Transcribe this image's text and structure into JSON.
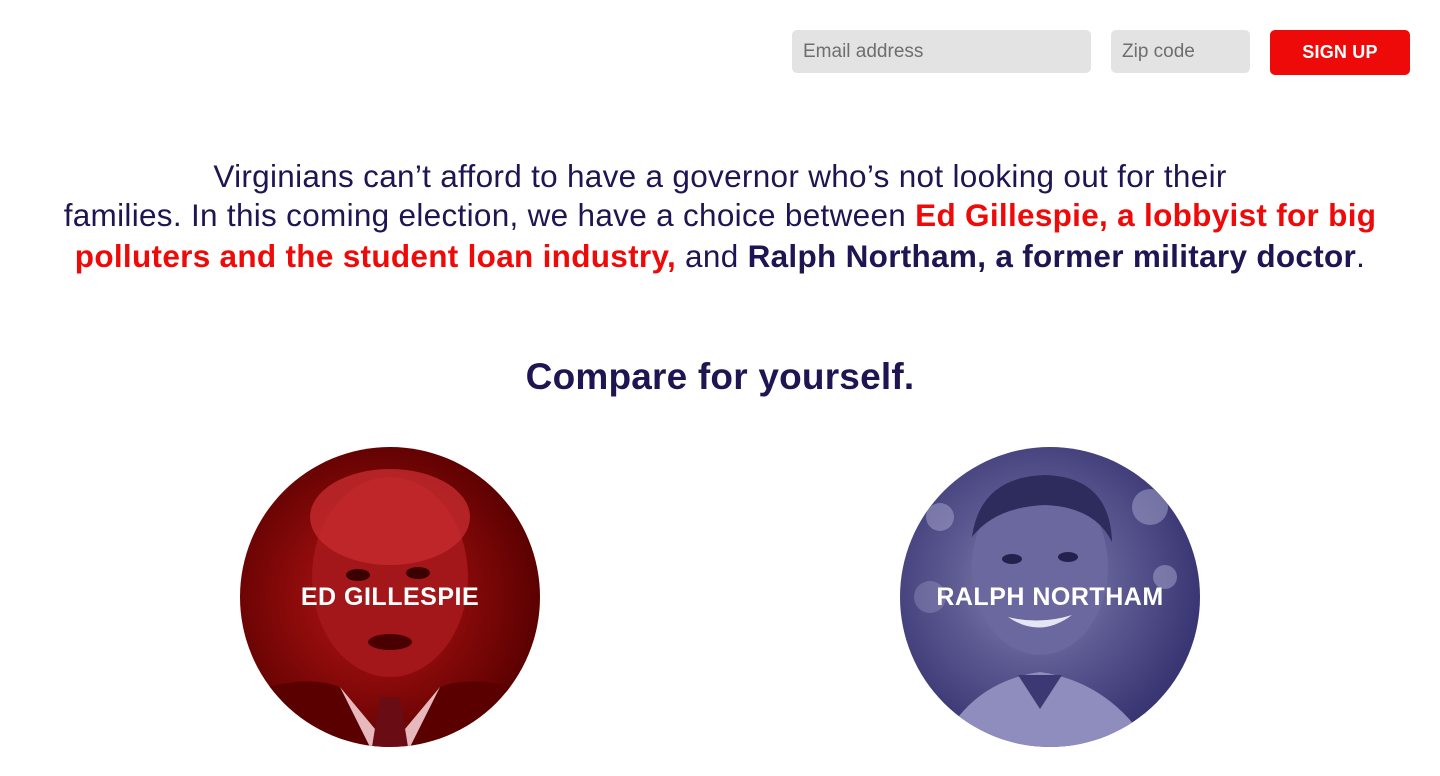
{
  "signup": {
    "email_placeholder": "Email address",
    "zip_placeholder": "Zip code",
    "button_label": "SIGN UP"
  },
  "intro": {
    "line1": "Virginians can’t afford to have a governor who’s not looking out for their",
    "part_plain1": "families. In this coming election, we have a choice between ",
    "part_red": "Ed Gillespie, a lobbyist for big polluters and the student loan industry,",
    "part_plain2": " and ",
    "part_navy": "Ralph Northam, a former military doctor",
    "part_end": "."
  },
  "compare_heading": "Compare for yourself.",
  "candidates": [
    {
      "name": "ED GILLESPIE"
    },
    {
      "name": "RALPH NORTHAM"
    }
  ],
  "colors": {
    "navy": "#1f1553",
    "red": "#ef0a0a",
    "field_bg": "#e3e3e3"
  }
}
